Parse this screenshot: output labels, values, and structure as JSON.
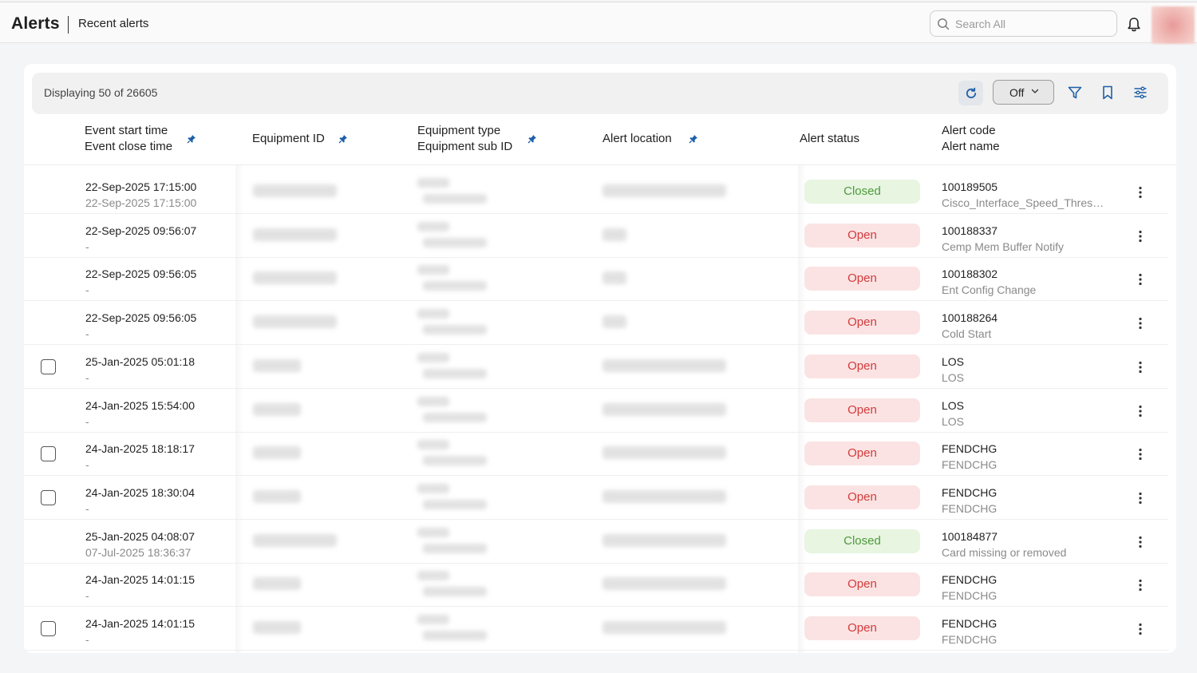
{
  "header": {
    "title": "Alerts",
    "breadcrumb": "Recent alerts",
    "search_placeholder": "Search All"
  },
  "toolbar": {
    "count_text": "Displaying 50 of 26605",
    "auto_refresh_value": "Off"
  },
  "columns": {
    "time_start": "Event start time",
    "time_close": "Event close time",
    "equipment_id": "Equipment ID",
    "equip_type": "Equipment type",
    "equip_sub": "Equipment sub ID",
    "location": "Alert location",
    "status": "Alert status",
    "code": "Alert code",
    "name": "Alert name"
  },
  "colors": {
    "open_bg": "#fbe3e3",
    "open_text": "#d23b3b",
    "closed_bg": "#e7f5e1",
    "closed_text": "#4f9a3c",
    "accent": "#1f5fa8"
  },
  "rows": [
    {
      "checkbox": false,
      "start": "22-Sep-2025 17:15:00",
      "close": "22-Sep-2025 17:15:00",
      "status": "Closed",
      "code": "100189505",
      "name": "Cisco_Interface_Speed_Threshold"
    },
    {
      "checkbox": false,
      "start": "22-Sep-2025 09:56:07",
      "close": "-",
      "status": "Open",
      "code": "100188337",
      "name": "Cemp Mem Buffer Notify"
    },
    {
      "checkbox": false,
      "start": "22-Sep-2025 09:56:05",
      "close": "-",
      "status": "Open",
      "code": "100188302",
      "name": "Ent Config Change"
    },
    {
      "checkbox": false,
      "start": "22-Sep-2025 09:56:05",
      "close": "-",
      "status": "Open",
      "code": "100188264",
      "name": "Cold Start"
    },
    {
      "checkbox": true,
      "start": "25-Jan-2025 05:01:18",
      "close": "-",
      "status": "Open",
      "code": "LOS",
      "name": "LOS"
    },
    {
      "checkbox": false,
      "start": "24-Jan-2025 15:54:00",
      "close": "-",
      "status": "Open",
      "code": "LOS",
      "name": "LOS"
    },
    {
      "checkbox": true,
      "start": "24-Jan-2025 18:18:17",
      "close": "-",
      "status": "Open",
      "code": "FENDCHG",
      "name": "FENDCHG"
    },
    {
      "checkbox": true,
      "start": "24-Jan-2025 18:30:04",
      "close": "-",
      "status": "Open",
      "code": "FENDCHG",
      "name": "FENDCHG"
    },
    {
      "checkbox": false,
      "start": "25-Jan-2025 04:08:07",
      "close": "07-Jul-2025 18:36:37",
      "status": "Closed",
      "code": "100184877",
      "name": "Card missing or removed"
    },
    {
      "checkbox": false,
      "start": "24-Jan-2025 14:01:15",
      "close": "-",
      "status": "Open",
      "code": "FENDCHG",
      "name": "FENDCHG"
    },
    {
      "checkbox": true,
      "start": "24-Jan-2025 14:01:15",
      "close": "-",
      "status": "Open",
      "code": "FENDCHG",
      "name": "FENDCHG"
    }
  ]
}
